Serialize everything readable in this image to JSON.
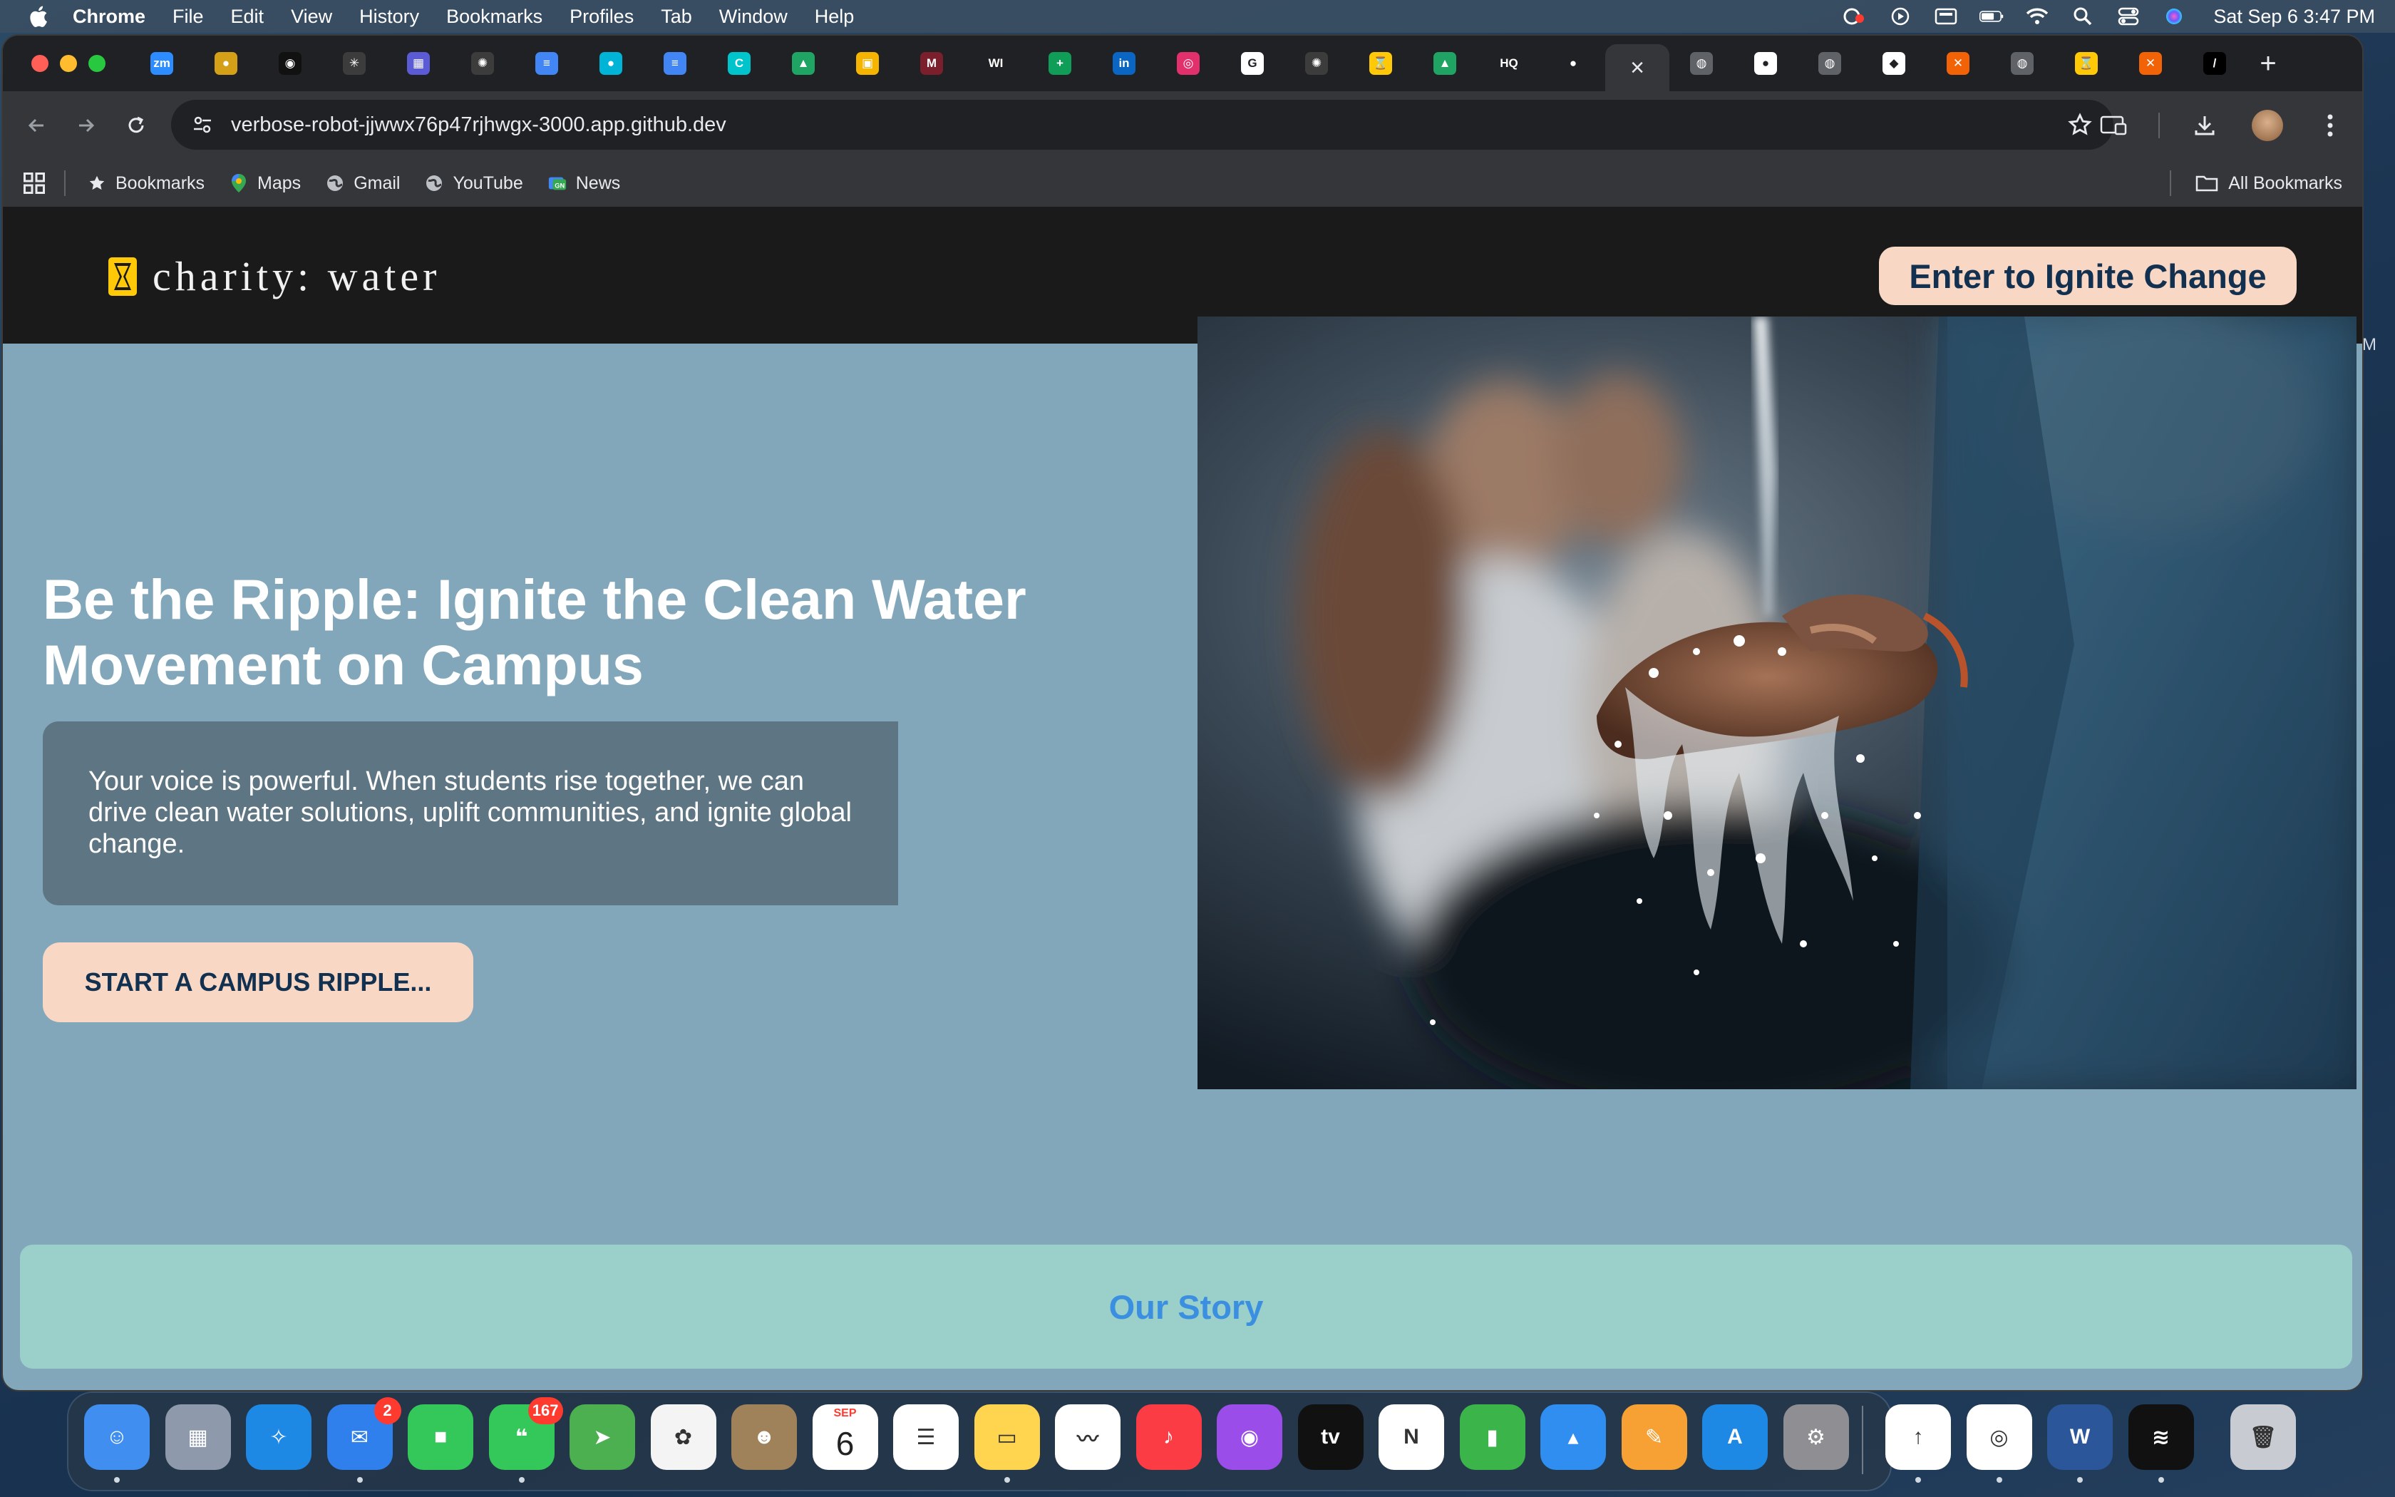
{
  "menubar": {
    "app_name": "Chrome",
    "items": [
      "File",
      "Edit",
      "View",
      "History",
      "Bookmarks",
      "Profiles",
      "Tab",
      "Window",
      "Help"
    ],
    "status_icons": [
      "screen-share-icon",
      "play-icon",
      "display-icon",
      "battery-icon",
      "wifi-icon",
      "search-icon",
      "control-center-icon",
      "siri-icon"
    ],
    "clock": "Sat Sep 6  3:47 PM"
  },
  "browser": {
    "tabs": [
      {
        "icon": "zoom-icon",
        "glyph": "zm",
        "color": "#2d8cff"
      },
      {
        "icon": "tab-icon",
        "glyph": "●",
        "color": "#d4a017"
      },
      {
        "icon": "tab-icon",
        "glyph": "◉",
        "color": "#111111"
      },
      {
        "icon": "sparkle-icon",
        "glyph": "✳",
        "color": "#3c3c3c"
      },
      {
        "icon": "calendar-icon",
        "glyph": "▦",
        "color": "#5b5bd6"
      },
      {
        "icon": "openai-icon",
        "glyph": "✺",
        "color": "#3c3c3c"
      },
      {
        "icon": "docs-icon",
        "glyph": "≡",
        "color": "#4285f4"
      },
      {
        "icon": "droplet-icon",
        "glyph": "●",
        "color": "#00b4d8"
      },
      {
        "icon": "docs-icon",
        "glyph": "≡",
        "color": "#4285f4"
      },
      {
        "icon": "canva-icon",
        "glyph": "C",
        "color": "#00c4cc"
      },
      {
        "icon": "drive-icon",
        "glyph": "▲",
        "color": "#1fa463"
      },
      {
        "icon": "photo-icon",
        "glyph": "▣",
        "color": "#f4b400"
      },
      {
        "icon": "miro-icon",
        "glyph": "M",
        "color": "#7a1f2b"
      },
      {
        "icon": "wi-icon",
        "glyph": "WI",
        "color": "#202124"
      },
      {
        "icon": "sheets-icon",
        "glyph": "+",
        "color": "#0f9d58"
      },
      {
        "icon": "linkedin-icon",
        "glyph": "in",
        "color": "#0a66c2"
      },
      {
        "icon": "instagram-icon",
        "glyph": "◎",
        "color": "#e1306c"
      },
      {
        "icon": "google-icon",
        "glyph": "G",
        "color": "#ffffff"
      },
      {
        "icon": "openai-icon",
        "glyph": "✺",
        "color": "#3c3c3c"
      },
      {
        "icon": "charity-water-icon",
        "glyph": "⌛",
        "color": "#ffc907"
      },
      {
        "icon": "drive-icon",
        "glyph": "▲",
        "color": "#1fa463"
      },
      {
        "icon": "hq-icon",
        "glyph": "HQ",
        "color": "#202124"
      },
      {
        "icon": "github-icon",
        "glyph": "●",
        "color": "#202124"
      }
    ],
    "active_tab": {
      "icon": "close-icon",
      "glyph": "×"
    },
    "tabs_after": [
      {
        "icon": "globe-icon",
        "glyph": "◍",
        "color": "#5f6368"
      },
      {
        "icon": "github-icon",
        "glyph": "●",
        "color": "#ffffff"
      },
      {
        "icon": "globe-icon",
        "glyph": "◍",
        "color": "#5f6368"
      },
      {
        "icon": "copilot-icon",
        "glyph": "◆",
        "color": "#ffffff"
      },
      {
        "icon": "replit-icon",
        "glyph": "✕",
        "color": "#f26207"
      },
      {
        "icon": "globe-icon",
        "glyph": "◍",
        "color": "#5f6368"
      },
      {
        "icon": "charity-water-icon",
        "glyph": "⌛",
        "color": "#ffc907"
      },
      {
        "icon": "replit-icon",
        "glyph": "✕",
        "color": "#f26207"
      },
      {
        "icon": "cursor-icon",
        "glyph": "/",
        "color": "#000000"
      }
    ],
    "new_tab": "+",
    "url": "verbose-robot-jjwwx76p47rjhwgx-3000.app.github.dev",
    "bookmarks": [
      {
        "label": "Bookmarks",
        "icon": "star-icon"
      },
      {
        "label": "Maps",
        "icon": "maps-icon"
      },
      {
        "label": "Gmail",
        "icon": "globe-icon"
      },
      {
        "label": "YouTube",
        "icon": "globe-icon"
      },
      {
        "label": "News",
        "icon": "news-icon"
      }
    ],
    "all_bookmarks": "All Bookmarks"
  },
  "site": {
    "logo_text": "charity: water",
    "header_cta": "Enter to Ignite Change",
    "hero_title": "Be the Ripple: Ignite the Clean Water Movement on Campus",
    "hero_text": "Your voice is powerful. When students rise together, we can drive clean water solutions, uplift communities, and ignite global change.",
    "hero_cta": "START A CAMPUS RIPPLE...",
    "story_heading": "Our Story",
    "right_edge_text": "M",
    "colors": {
      "cta_bg": "#f8d7c4",
      "cta_text": "#12304f",
      "hero_bg": "#82a7ba",
      "story_bg": "#9bcfca",
      "story_text": "#3b8fe0"
    }
  },
  "dock": {
    "apps": [
      {
        "name": "finder",
        "glyph": "☺",
        "color": "#3f8ef0",
        "dot": true
      },
      {
        "name": "launchpad",
        "glyph": "▦",
        "color": "#8e9aab",
        "dot": false
      },
      {
        "name": "safari",
        "glyph": "✧",
        "color": "#1e88e5",
        "dot": false
      },
      {
        "name": "mail",
        "glyph": "✉",
        "color": "#2f80ed",
        "badge": "2",
        "dot": true
      },
      {
        "name": "facetime",
        "glyph": "■",
        "color": "#34c759",
        "dot": false
      },
      {
        "name": "messages",
        "glyph": "❝",
        "color": "#34c759",
        "badge": "167",
        "dot": true
      },
      {
        "name": "maps",
        "glyph": "➤",
        "color": "#4caf50",
        "dot": false
      },
      {
        "name": "photos",
        "glyph": "✿",
        "color": "#f4f4f4",
        "dot": false
      },
      {
        "name": "contacts",
        "glyph": "☻",
        "color": "#a0825a",
        "dot": false
      },
      {
        "name": "calendar",
        "glyph": "6",
        "color": "#ffffff",
        "month": "SEP",
        "dot": false
      },
      {
        "name": "reminders",
        "glyph": "☰",
        "color": "#ffffff",
        "dot": false
      },
      {
        "name": "notes",
        "glyph": "▭",
        "color": "#ffd54f",
        "dot": true
      },
      {
        "name": "freeform",
        "glyph": "〰",
        "color": "#ffffff",
        "dot": false
      },
      {
        "name": "music",
        "glyph": "♪",
        "color": "#fc3c44",
        "dot": false
      },
      {
        "name": "podcasts",
        "glyph": "◉",
        "color": "#9b4dea",
        "dot": false
      },
      {
        "name": "tv",
        "glyph": "tv",
        "color": "#111111",
        "dot": false
      },
      {
        "name": "news",
        "glyph": "N",
        "color": "#ffffff",
        "dot": false
      },
      {
        "name": "numbers",
        "glyph": "▮",
        "color": "#3bb54a",
        "dot": false
      },
      {
        "name": "keynote",
        "glyph": "▴",
        "color": "#2f8ef0",
        "dot": false
      },
      {
        "name": "pages",
        "glyph": "✎",
        "color": "#f7a033",
        "dot": false
      },
      {
        "name": "app-store",
        "glyph": "A",
        "color": "#1e88e5",
        "dot": false
      },
      {
        "name": "system-settings",
        "glyph": "⚙",
        "color": "#8e8e93",
        "dot": false
      },
      {
        "name": "transloader",
        "glyph": "↑",
        "color": "#ffffff",
        "dot": true
      },
      {
        "name": "chrome",
        "glyph": "◎",
        "color": "#ffffff",
        "dot": true
      },
      {
        "name": "word",
        "glyph": "W",
        "color": "#2b579a",
        "dot": true
      },
      {
        "name": "spotify",
        "glyph": "≋",
        "color": "#111111",
        "dot": true
      },
      {
        "name": "trash",
        "glyph": "🗑",
        "color": "#c8ccd2",
        "dot": false
      }
    ]
  }
}
